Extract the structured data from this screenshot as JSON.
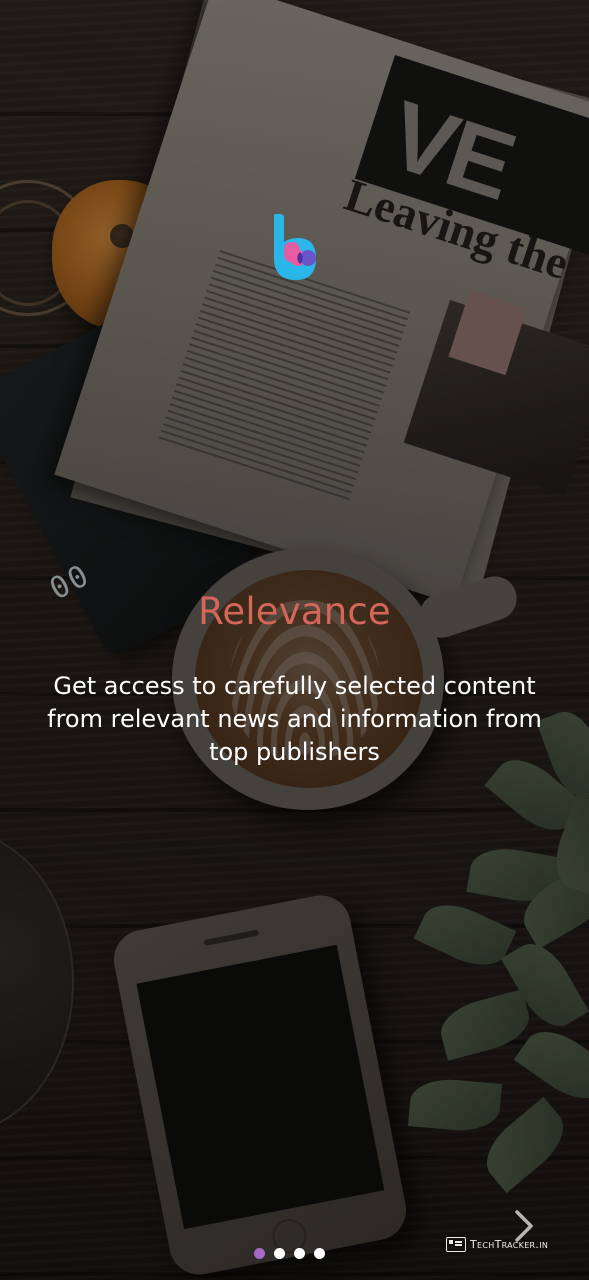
{
  "onboarding": {
    "title": "Relevance",
    "description": "Get access to carefully selected content from relevant news and information from top publishers",
    "pager": {
      "total_pages": 4,
      "current_page": 1
    },
    "next_icon": "chevron-right-icon"
  },
  "logo": {
    "icon": "app-logo-b"
  },
  "watermark": {
    "text": "TechTracker.in",
    "icon": "browser-window-icon"
  },
  "colors": {
    "title": "#d4675a",
    "description": "#ffffff",
    "dot_active": "#a869c7",
    "dot_inactive": "#ffffff",
    "logo_blue": "#2bb6ea",
    "logo_pink": "#ec5aa0",
    "logo_purple": "#6a55c8"
  }
}
